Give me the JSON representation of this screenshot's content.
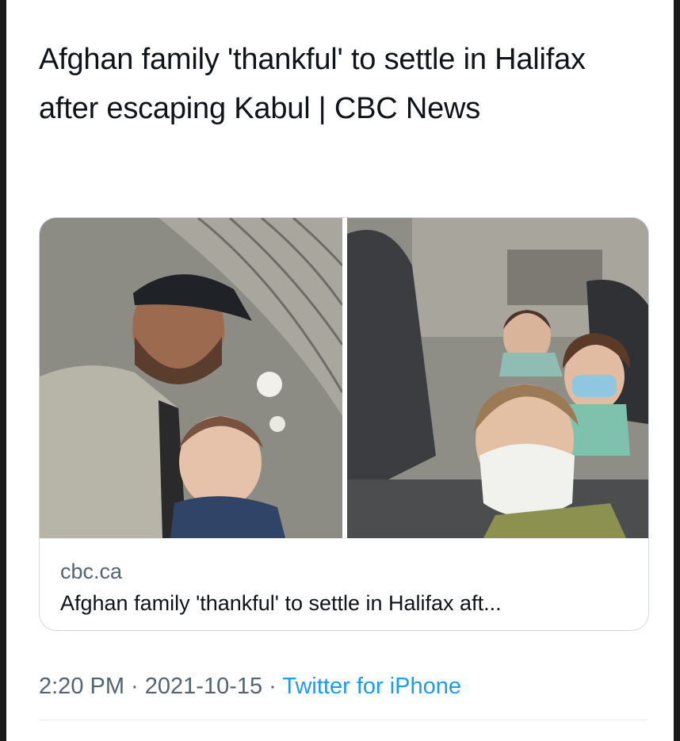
{
  "tweet": {
    "text": "Afghan family 'thankful' to settle in Halifax after escaping Kabul | CBC News"
  },
  "link_card": {
    "domain": "cbc.ca",
    "title": "Afghan family 'thankful' to settle in Halifax aft...",
    "image_alt": "Photo collage of a man with a baby and children wearing masks aboard a military aircraft"
  },
  "meta": {
    "time": "2:20 PM",
    "separator": " · ",
    "date": "2021-10-15",
    "source": "Twitter for iPhone"
  },
  "colors": {
    "text": "#0f1419",
    "secondary": "#536471",
    "link": "#1d9bf0",
    "border": "#cfd9de"
  }
}
